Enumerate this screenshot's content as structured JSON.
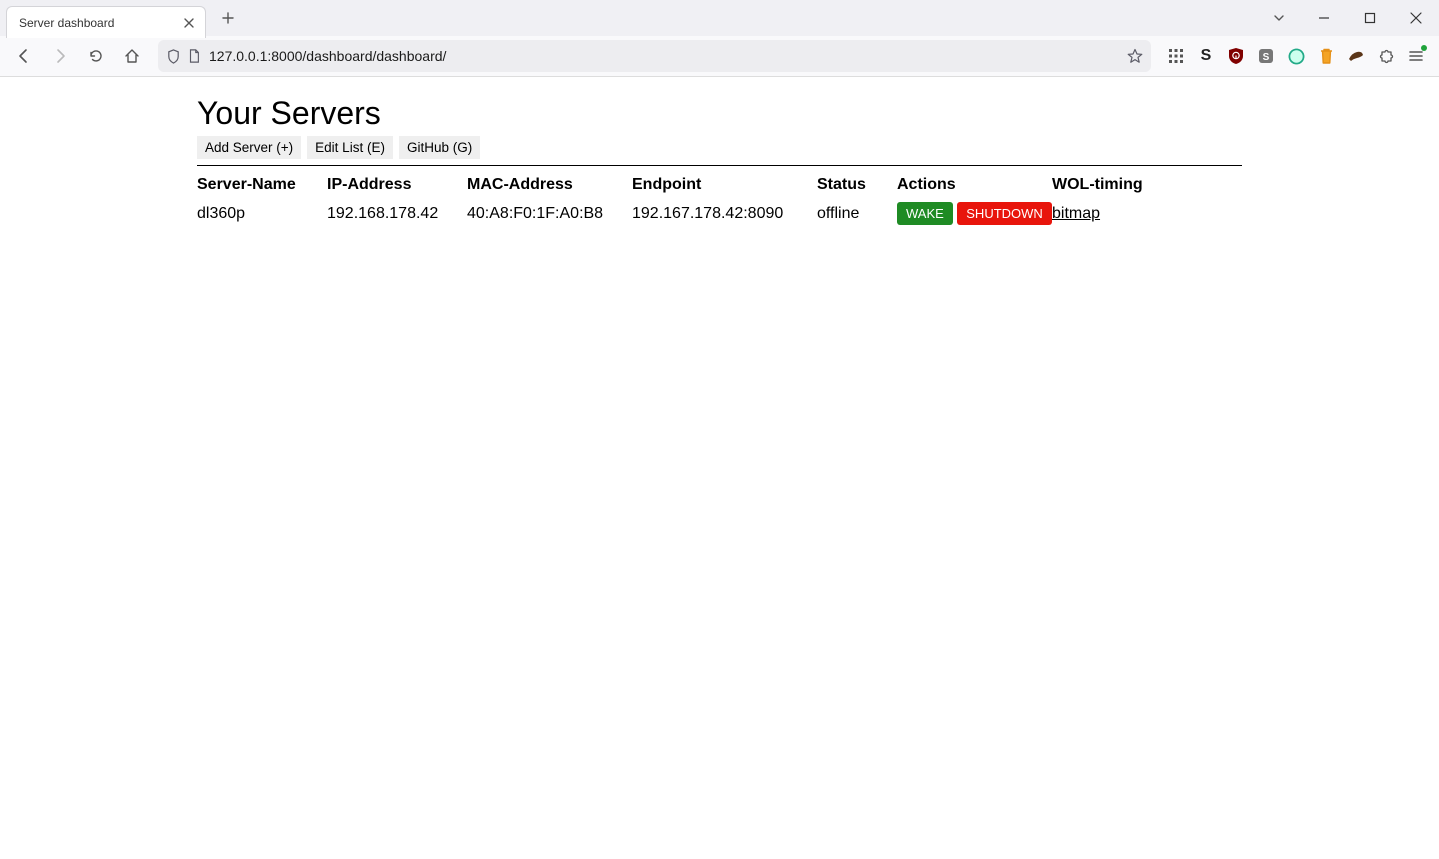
{
  "browser": {
    "tab_title": "Server dashboard",
    "url": "127.0.0.1:8000/dashboard/dashboard/"
  },
  "page": {
    "heading": "Your Servers",
    "buttons": {
      "add": "Add Server (+)",
      "edit": "Edit List (E)",
      "github": "GitHub (G)"
    },
    "table": {
      "headers": {
        "name": "Server-Name",
        "ip": "IP-Address",
        "mac": "MAC-Address",
        "endpoint": "Endpoint",
        "status": "Status",
        "actions": "Actions",
        "wol": "WOL-timing"
      },
      "rows": [
        {
          "name": "dl360p",
          "ip": "192.168.178.42",
          "mac": "40:A8:F0:1F:A0:B8",
          "endpoint": "192.167.178.42:8090",
          "status": "offline",
          "action_wake": "WAKE",
          "action_shutdown": "SHUTDOWN",
          "wol": "bitmap"
        }
      ]
    }
  }
}
